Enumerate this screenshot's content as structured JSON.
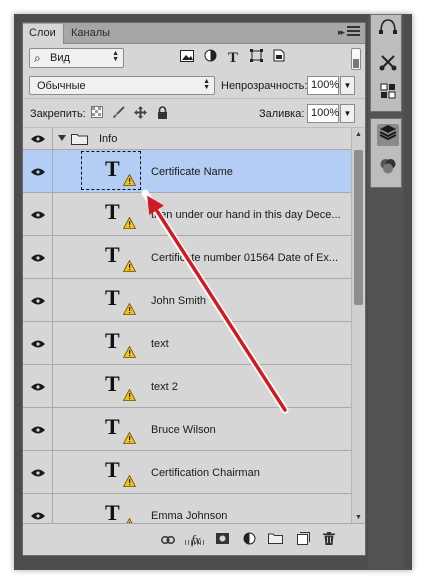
{
  "tabs": {
    "layers": "Слои",
    "channels": "Каналы",
    "collapse_glyph": "▸▸"
  },
  "filter": {
    "kind_label": "Вид",
    "search_glyph": "⌕"
  },
  "blend": {
    "mode": "Обычные",
    "opacity_label": "Непрозрачность:",
    "opacity_value": "100%"
  },
  "lock": {
    "label": "Закрепить:",
    "fill_label": "Заливка:",
    "fill_value": "100%"
  },
  "group": {
    "name": "Info"
  },
  "layers": [
    {
      "name": "Certificate Name",
      "selected": true
    },
    {
      "name": "then under our hand in this day Dece..."
    },
    {
      "name": "Certificate number   01564 Date of Ex..."
    },
    {
      "name": "John Smith"
    },
    {
      "name": "text"
    },
    {
      "name": "text 2"
    },
    {
      "name": "Bruce Wilson"
    },
    {
      "name": "Certification Chairman"
    },
    {
      "name": "Emma Johnson"
    }
  ],
  "layer_thumb_letter": "T",
  "bottom_icons": [
    "link-icon",
    "fx-icon",
    "mask-icon",
    "adjustment-icon",
    "folder-icon",
    "new-layer-icon",
    "trash-icon"
  ],
  "bottom_fx_label": "fx",
  "colors": {
    "selected_row": "#b4cdf4",
    "annotation_arrow": "#d01a24",
    "warning": "#f2c318"
  }
}
